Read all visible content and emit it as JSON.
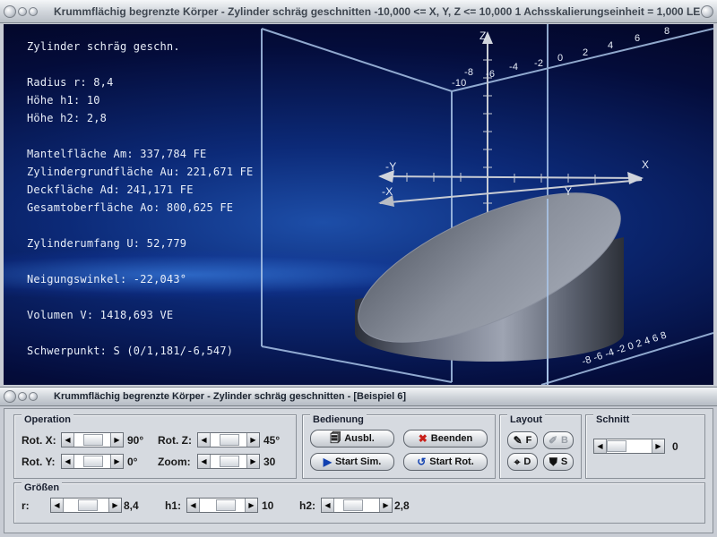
{
  "window": {
    "title": "Krummflächig begrenzte Körper - Zylinder schräg geschnitten   -10,000 <= X, Y, Z <= 10,000    1 Achsskalierungseinheit = 1,000 LE"
  },
  "info": {
    "heading": "Zylinder schräg geschn.",
    "radius": "Radius r: 8,4",
    "hoehe1": "Höhe h1: 10",
    "hoehe2": "Höhe h2: 2,8",
    "mantel": "Mantelfläche Am: 337,784 FE",
    "grund": "Zylindergrundfläche Au: 221,671 FE",
    "deck": "Deckfläche Ad: 241,171 FE",
    "gesamt": "Gesamtoberfläche Ao: 800,625 FE",
    "umfang": "Zylinderumfang U: 52,779",
    "neigung": "Neigungswinkel: -22,043°",
    "volumen": "Volumen V: 1418,693 VE",
    "schwerpunkt": "Schwerpunkt: S (0/1,181/-6,547)"
  },
  "axes": {
    "z": "Z",
    "x": "X",
    "y_neg": "-Y",
    "x_neg": "-X",
    "y": "Y",
    "top_ticks": [
      "-10",
      "-8",
      "-6",
      "-4",
      "-2",
      "0",
      "2",
      "4",
      "6",
      "8"
    ],
    "bottom_ticks": "-8 -6 -4 -2 0 2 4 6 8"
  },
  "panel_window": {
    "title": "Krummflächig begrenzte Körper - Zylinder schräg geschnitten - [Beispiel 6]"
  },
  "operation": {
    "title": "Operation",
    "rotx_label": "Rot. X:",
    "rotx_value": "90°",
    "roty_label": "Rot. Y:",
    "roty_value": "0°",
    "rotz_label": "Rot. Z:",
    "rotz_value": "45°",
    "zoom_label": "Zoom:",
    "zoom_value": "30"
  },
  "bedienung": {
    "title": "Bedienung",
    "ausbl": "Ausbl.",
    "beenden": "Beenden",
    "start_sim": "Start Sim.",
    "start_rot": "Start Rot."
  },
  "layout": {
    "title": "Layout",
    "f": "F",
    "b": "B",
    "d": "D",
    "s": "S"
  },
  "schnitt": {
    "title": "Schnitt",
    "value": "0"
  },
  "groessen": {
    "title": "Größen",
    "r_label": "r:",
    "r_value": "8,4",
    "h1_label": "h1:",
    "h1_value": "10",
    "h2_label": "h2:",
    "h2_value": "2,8"
  },
  "colors": {
    "accent_blue": "#0c2a78",
    "close_red": "#c8201a"
  }
}
